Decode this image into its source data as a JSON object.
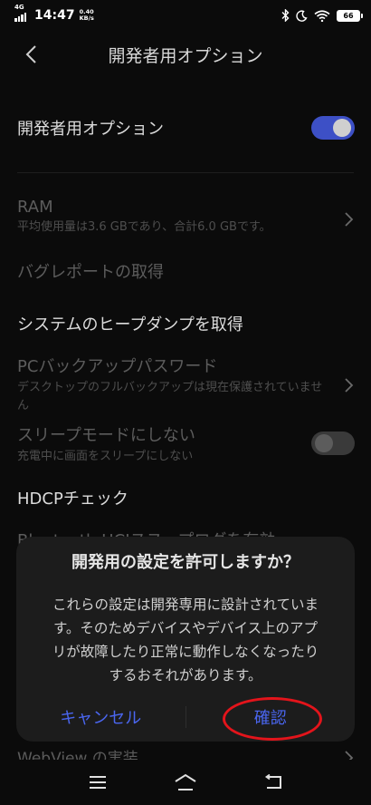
{
  "status_bar": {
    "network": "4G",
    "time": "14:47",
    "speed_value": "0.40",
    "speed_unit": "KB/s",
    "battery": "66"
  },
  "app_bar": {
    "title": "開発者用オプション"
  },
  "settings": {
    "developer_options": {
      "label": "開発者用オプション",
      "enabled": true
    },
    "ram": {
      "label": "RAM",
      "summary": "平均使用量は3.6 GBであり、合計6.0 GBです。"
    },
    "bug_report": {
      "label": "バグレポートの取得"
    },
    "heap_dump": {
      "label": "システムのヒープダンプを取得"
    },
    "backup_password": {
      "label": "PCバックアップパスワード",
      "summary": "デスクトップのフルバックアップは現在保護されていません"
    },
    "stay_awake": {
      "label": "スリープモードにしない",
      "summary": "充電中に画面をスリープにしない",
      "enabled": false
    },
    "hdcp": {
      "label": "HDCPチェック"
    },
    "bluetooth_hci": {
      "label": "Bluetooth HCIスヌープログを有効"
    },
    "webview": {
      "label": "WebView の実装"
    }
  },
  "dialog": {
    "title": "開発用の設定を許可しますか？",
    "message": "これらの設定は開発専用に設計されています。そのためデバイスやデバイス上のアプリが故障したり正常に動作しなくなったりするおそれがあります。",
    "cancel_label": "キャンセル",
    "confirm_label": "確認"
  },
  "colors": {
    "accent": "#4a66f0",
    "toggle_on": "#3d50c6",
    "highlight_ring": "#e3141b"
  }
}
